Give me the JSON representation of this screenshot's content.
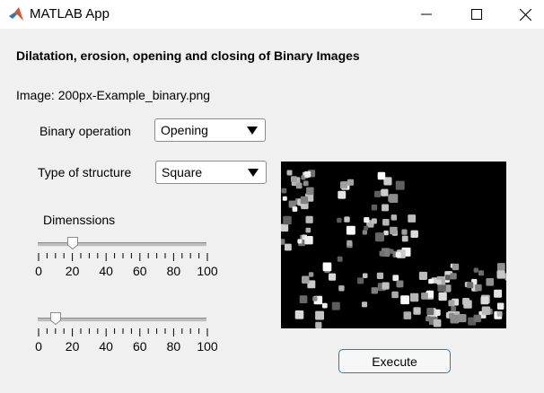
{
  "window": {
    "title": "MATLAB App",
    "icon": "matlab-logo-icon",
    "controls": [
      "minimize-icon",
      "maximize-icon",
      "close-icon"
    ]
  },
  "heading": "Dilatation, erosion, opening and closing of Binary Images",
  "image_label": "Image: 200px-Example_binary.png",
  "binary_operation": {
    "label": "Binary operation",
    "selected": "Opening"
  },
  "structure_type": {
    "label": "Type of structure",
    "selected": "Square"
  },
  "dimensions": {
    "label": "Dimenssions",
    "slider1": {
      "value": 20,
      "min": 0,
      "max": 100
    },
    "slider2": {
      "value": 10,
      "min": 0,
      "max": 100
    },
    "tick_labels": [
      "0",
      "20",
      "40",
      "60",
      "80",
      "100"
    ]
  },
  "execute_button": {
    "label": "Execute"
  },
  "colors": {
    "background": "#f0f0f0",
    "button_border": "#2e7ab8",
    "image_background": "#000000"
  }
}
